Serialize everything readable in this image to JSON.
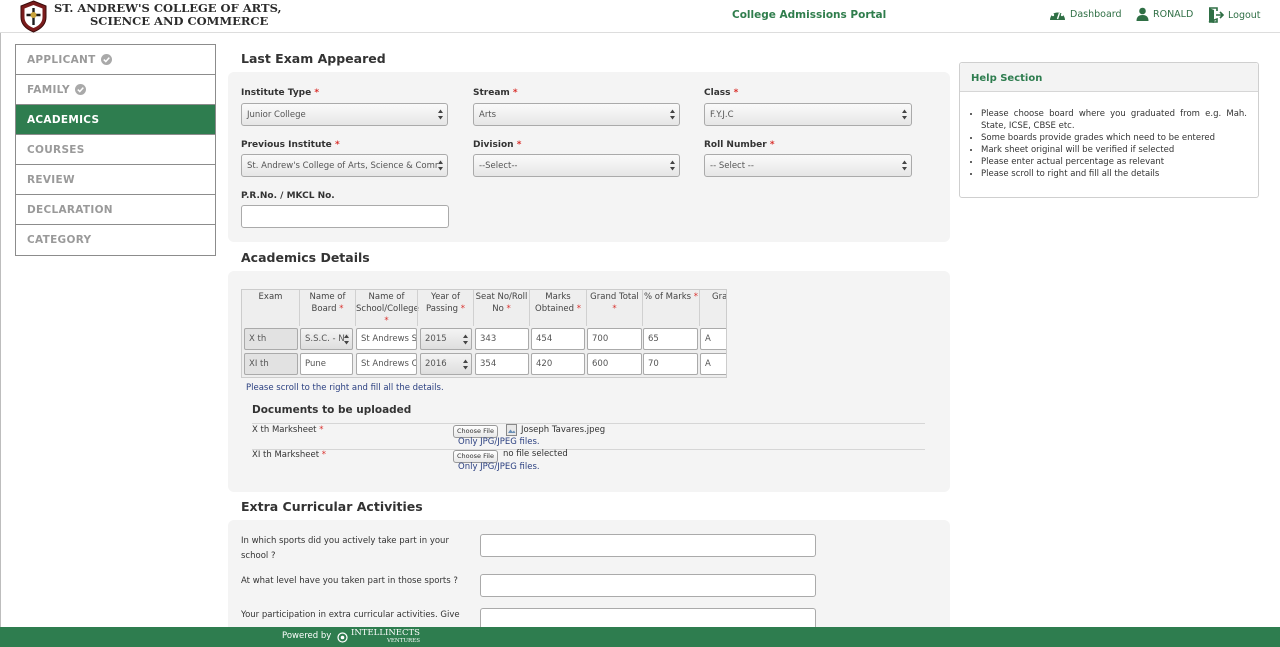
{
  "header": {
    "college_line1": "ST. ANDREW'S COLLEGE OF ARTS,",
    "college_line2": "SCIENCE AND COMMERCE",
    "portal_title": "College Admissions Portal",
    "nav": {
      "dashboard": "Dashboard",
      "user": "RONALD",
      "logout": "Logout"
    }
  },
  "sidebar": {
    "items": [
      {
        "label": "APPLICANT",
        "done": true
      },
      {
        "label": "FAMILY",
        "done": true
      },
      {
        "label": "ACADEMICS",
        "active": true
      },
      {
        "label": "COURSES"
      },
      {
        "label": "REVIEW"
      },
      {
        "label": "DECLARATION"
      },
      {
        "label": "CATEGORY"
      }
    ]
  },
  "last_exam": {
    "title": "Last Exam Appeared",
    "institute_type": {
      "label": "Institute Type",
      "value": "Junior College"
    },
    "stream": {
      "label": "Stream",
      "value": "Arts"
    },
    "class": {
      "label": "Class",
      "value": "F.Y.J.C"
    },
    "previous_institute": {
      "label": "Previous Institute",
      "value": "St. Andrew's College of Arts, Science & Comm"
    },
    "division": {
      "label": "Division",
      "value": "--Select--"
    },
    "roll_number": {
      "label": "Roll Number",
      "value": "-- Select --"
    },
    "prn": {
      "label": "P.R.No. / MKCL No.",
      "value": ""
    }
  },
  "academics": {
    "title": "Academics Details",
    "columns": {
      "exam": "Exam",
      "board": "Name of Board",
      "school": "Name of School/College",
      "year": "Year of Passing",
      "seat": "Seat No/Roll No",
      "marks": "Marks Obtained",
      "total": "Grand Total",
      "percent": "% of Marks",
      "grade": "Gra"
    },
    "rows": [
      {
        "exam": "X th",
        "board": "S.S.C. - N",
        "school": "St Andrews S",
        "year": "2015",
        "seat": "343",
        "marks": "454",
        "total": "700",
        "percent": "65",
        "grade": "A"
      },
      {
        "exam": "XI th",
        "board": "Pune",
        "school": "St Andrews C",
        "year": "2016",
        "seat": "354",
        "marks": "420",
        "total": "600",
        "percent": "70",
        "grade": "A"
      }
    ],
    "scroll_note": "Please scroll to the right and fill all the details."
  },
  "documents": {
    "title": "Documents to be uploaded",
    "choose_label": "Choose File",
    "hint": "Only JPG/JPEG files.",
    "items": [
      {
        "label": "X th Marksheet",
        "file": "Joseph Tavares.jpeg"
      },
      {
        "label": "XI th Marksheet",
        "file": "no file selected"
      }
    ]
  },
  "extra": {
    "title": "Extra Curricular Activities",
    "questions": [
      "In which sports did you actively take part in your school ?",
      "At what level have you taken part in those sports ?",
      "Your participation in extra curricular activities. Give"
    ]
  },
  "help": {
    "title": "Help Section",
    "items": [
      "Please choose board where you graduated from e.g. Mah. State, ICSE, CBSE etc.",
      "Some boards provide grades which need to be entered",
      "Mark sheet original will be verified if selected",
      "Please enter actual percentage as relevant",
      "Please scroll to right and fill all the details"
    ]
  },
  "footer": {
    "powered_by": "Powered by",
    "brand": "INTELLINECTS",
    "brand_sub": "VENTURES"
  },
  "colors": {
    "primary_green": "#2e7d4f",
    "required_red": "#d9302c",
    "note_blue": "#2a3f80"
  }
}
